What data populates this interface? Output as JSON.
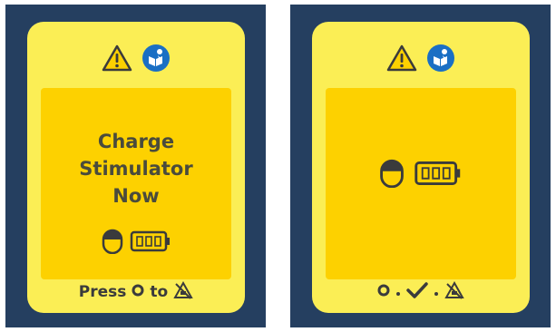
{
  "left_screen": {
    "message_lines": [
      "Charge",
      "Stimulator",
      "Now"
    ],
    "footer": {
      "press_text": "Press",
      "to_text": "to"
    },
    "icons": [
      "warning-icon",
      "manual-icon",
      "headpiece-icon",
      "battery-icon",
      "button-icon",
      "no-mri-icon"
    ]
  },
  "right_screen": {
    "footer_sequence": [
      "button-icon",
      "dot",
      "checkmark-icon",
      "dot",
      "no-mri-icon"
    ],
    "icons": [
      "warning-icon",
      "manual-icon",
      "headpiece-icon",
      "battery-icon"
    ]
  },
  "colors": {
    "frame": "#253f60",
    "screen": "#fbee55",
    "message_box": "#fdd100",
    "text": "#4a4b3c",
    "manual_icon_blue": "#1a6fc4"
  }
}
